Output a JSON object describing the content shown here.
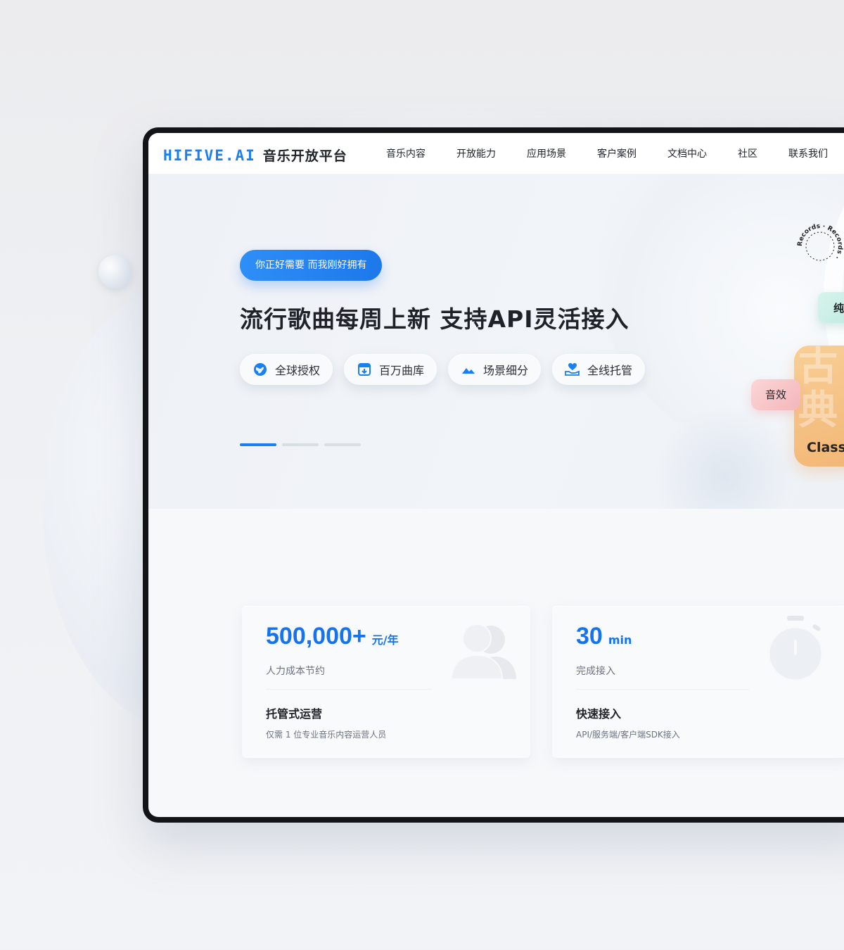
{
  "nav": {
    "logo_mark": "HIFIVE.AI",
    "logo_text": "音乐开放平台",
    "items": [
      "音乐内容",
      "开放能力",
      "应用场景",
      "客户案例",
      "文档中心",
      "社区",
      "联系我们"
    ]
  },
  "hero": {
    "tag": "你正好需要 而我刚好拥有",
    "title": "流行歌曲每周上新 支持API灵活接入",
    "features": [
      {
        "label": "全球授权",
        "icon": "globe-icon"
      },
      {
        "label": "百万曲库",
        "icon": "library-icon"
      },
      {
        "label": "场景细分",
        "icon": "mountain-icon"
      },
      {
        "label": "全线托管",
        "icon": "hand-heart-icon"
      }
    ],
    "carousel_active": 0,
    "art": {
      "records_text": "Records · Records ·",
      "pure_chip": "纯",
      "classic_big": "古典",
      "classic_en": "Classic",
      "sfx_chip": "音效"
    }
  },
  "stats": [
    {
      "number": "500,000+",
      "unit": "元/年",
      "sub": "人力成本节约",
      "heading": "托管式运营",
      "desc": "仅需 1 位专业音乐内容运营人员",
      "icon": "users-icon"
    },
    {
      "number": "30",
      "unit": "min",
      "sub": "完成接入",
      "heading": "快速接入",
      "desc": "API/服务端/客户端SDK接入",
      "icon": "stopwatch-icon"
    }
  ],
  "colors": {
    "brand": "#1a7ff0",
    "classic": "#f2b674",
    "sfx": "#f4b6ba",
    "pure": "#bfeadf"
  }
}
